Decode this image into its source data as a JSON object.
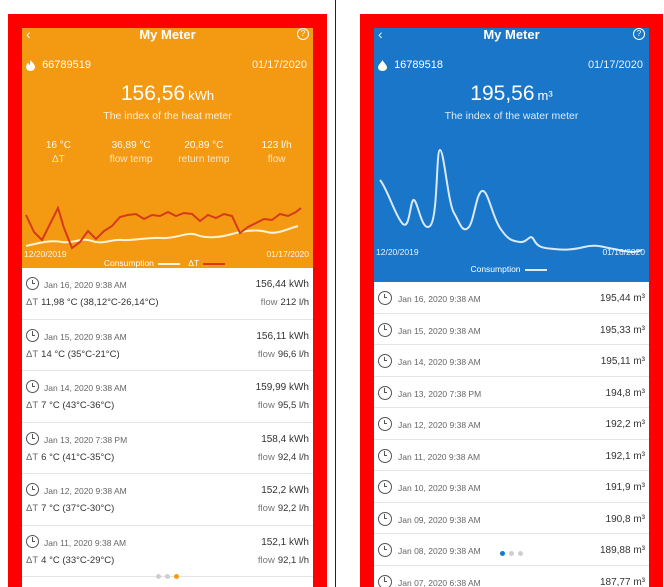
{
  "heat": {
    "title": "My Meter",
    "help_icon": "?",
    "meter_id": "66789519",
    "meter_date": "01/17/2020",
    "reading_value": "156,56",
    "reading_unit": "kWh",
    "subtitle": "The index of the heat meter",
    "stats": [
      {
        "value": "16 °C",
        "label": "ΔT"
      },
      {
        "value": "36,89 °C",
        "label": "flow temp"
      },
      {
        "value": "20,89 °C",
        "label": "return temp"
      },
      {
        "value": "123 l/h",
        "label": "flow"
      }
    ],
    "chart_start": "12/20/2019",
    "chart_end": "01/17/2020",
    "legend_consumption": "Consumption",
    "legend_dt": "ΔT",
    "rows": [
      {
        "when": "Jan 16, 2020 9:38 AM",
        "kwh": "156,44 kWh",
        "dt": "11,98 °C (38,12°C-26,14°C)",
        "flow": "212 l/h"
      },
      {
        "when": "Jan 15, 2020 9:38 AM",
        "kwh": "156,11 kWh",
        "dt": "14 °C (35°C-21°C)",
        "flow": "96,6 l/h"
      },
      {
        "when": "Jan 14, 2020 9:38 AM",
        "kwh": "159,99 kWh",
        "dt": "7 °C (43°C-36°C)",
        "flow": "95,5 l/h"
      },
      {
        "when": "Jan 13, 2020 7:38 PM",
        "kwh": "158,4 kWh",
        "dt": "6 °C (41°C-35°C)",
        "flow": "92,4 l/h"
      },
      {
        "when": "Jan 12, 2020 9:38 AM",
        "kwh": "152,2 kWh",
        "dt": "7 °C (37°C-30°C)",
        "flow": "92,2 l/h"
      },
      {
        "when": "Jan 11, 2020 9:38 AM",
        "kwh": "152,1 kWh",
        "dt": "4 °C (33°C-29°C)",
        "flow": "92,1 l/h"
      }
    ],
    "dt_label": "ΔT",
    "flow_label": "flow",
    "colors": {
      "header": "#f39a12",
      "consumption": "#fff3d6",
      "dt": "#d63a1a"
    }
  },
  "water": {
    "title": "My Meter",
    "help_icon": "?",
    "meter_id": "16789518",
    "meter_date": "01/17/2020",
    "reading_value": "195,56",
    "reading_unit": "m³",
    "subtitle": "The index of the water meter",
    "chart_start": "12/20/2019",
    "chart_end": "01/16/2020",
    "legend_consumption": "Consumption",
    "rows": [
      {
        "when": "Jan 16, 2020 9:38 AM",
        "value": "195,44 m³"
      },
      {
        "when": "Jan 15, 2020 9:38 AM",
        "value": "195,33 m³"
      },
      {
        "when": "Jan 14, 2020 9:38 AM",
        "value": "195,11 m³"
      },
      {
        "when": "Jan 13, 2020 7:38 PM",
        "value": "194,8 m³"
      },
      {
        "when": "Jan 12, 2020 9:38 AM",
        "value": "192,2 m³"
      },
      {
        "when": "Jan 11, 2020 9:38 AM",
        "value": "192,1 m³"
      },
      {
        "when": "Jan 10, 2020 9:38 AM",
        "value": "191,9 m³"
      },
      {
        "when": "Jan 09, 2020 9:38 AM",
        "value": "190,8 m³"
      },
      {
        "when": "Jan 08, 2020 9:38 AM",
        "value": "189,88 m³"
      },
      {
        "when": "Jan 07, 2020 6:38 AM",
        "value": "187,77 m³"
      }
    ],
    "colors": {
      "header": "#1976c8",
      "consumption": "#dbe9f7"
    }
  }
}
